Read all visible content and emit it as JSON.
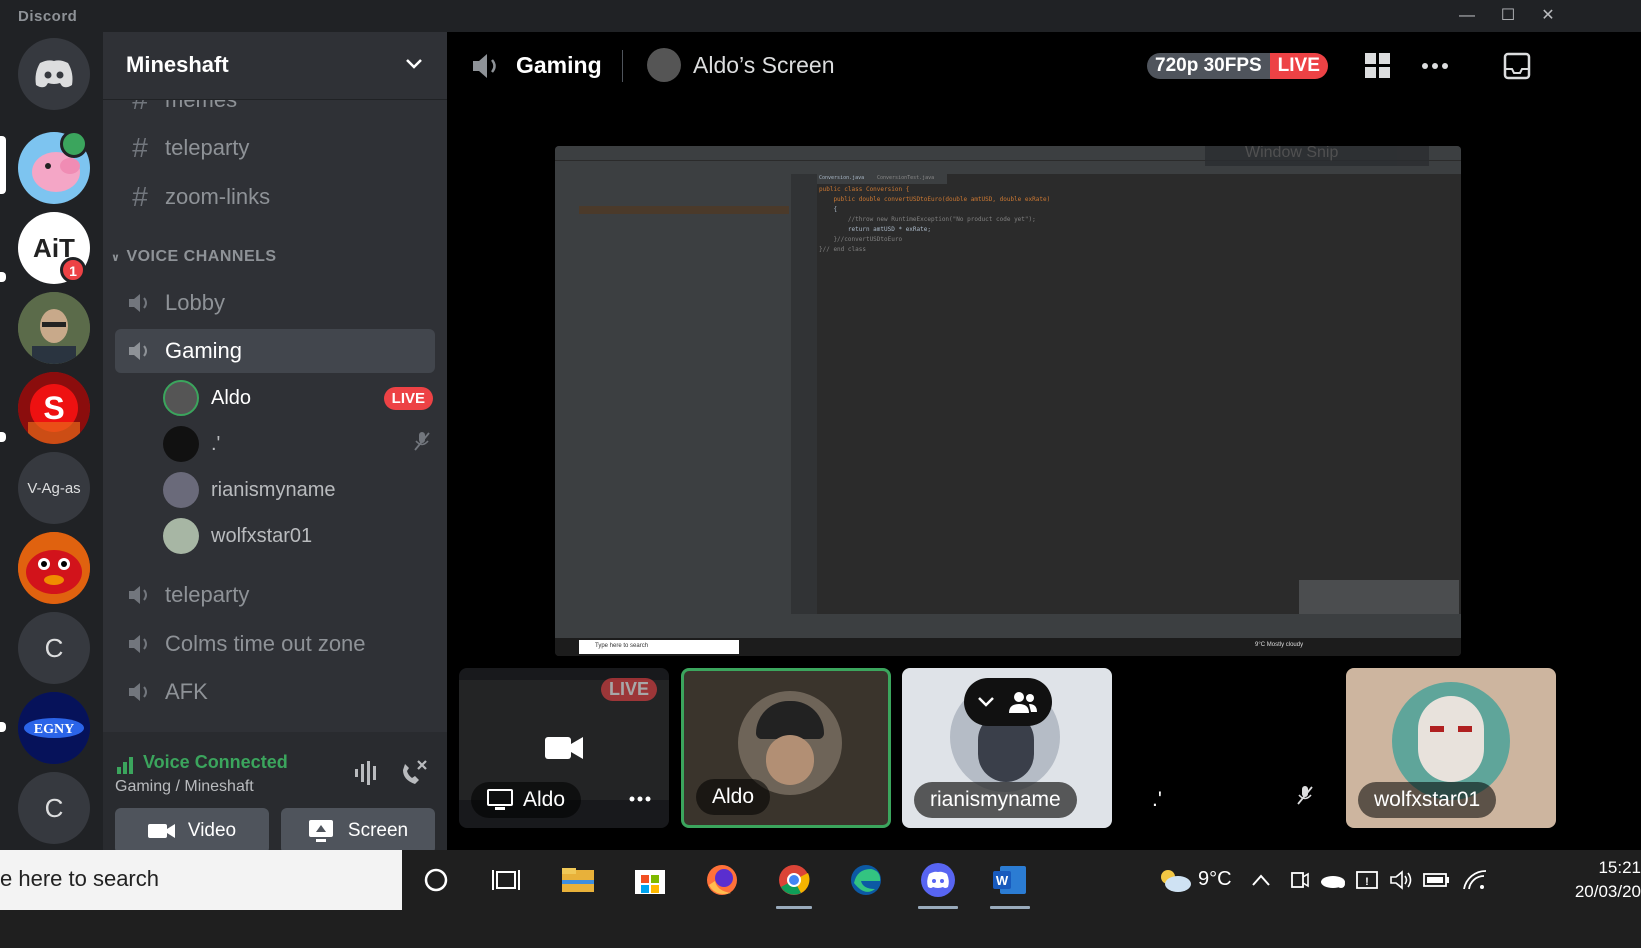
{
  "window": {
    "app_name": "Discord"
  },
  "guild": {
    "name": "Mineshaft"
  },
  "text_channels": [
    {
      "name": "memes"
    },
    {
      "name": "teleparty"
    },
    {
      "name": "zoom-links"
    }
  ],
  "voice_category": "VOICE CHANNELS",
  "voice_channels": [
    {
      "name": "Lobby"
    },
    {
      "name": "Gaming"
    },
    {
      "name": "teleparty"
    },
    {
      "name": "Colms time out zone"
    },
    {
      "name": "AFK"
    }
  ],
  "gaming_members": [
    {
      "name": "Aldo",
      "live": "LIVE"
    },
    {
      "name": ".'"
    },
    {
      "name": "rianismyname"
    },
    {
      "name": "wolfxstar01"
    }
  ],
  "servers": [
    {
      "label": "",
      "icon": "discord-home-icon"
    },
    {
      "label": "",
      "icon": "peppa-server-icon",
      "speaking": true
    },
    {
      "label": "AiT",
      "badge": "1"
    },
    {
      "label": "",
      "icon": "person-server-icon"
    },
    {
      "label": "S",
      "icon": "s-logo-server-icon"
    },
    {
      "label": "V-Ag-as"
    },
    {
      "label": "",
      "icon": "red-creature-server-icon"
    },
    {
      "label": "C"
    },
    {
      "label": "",
      "icon": "blue-logo-server-icon"
    },
    {
      "label": "C"
    }
  ],
  "voice_panel": {
    "status": "Voice Connected",
    "location": "Gaming / Mineshaft",
    "video_label": "Video",
    "screen_label": "Screen"
  },
  "stage": {
    "channel": "Gaming",
    "stream_title": "Aldo’s Screen",
    "quality": "720p 30FPS",
    "live": "LIVE"
  },
  "shared_screen": {
    "code_lines": [
      "public class Conversion {",
      "    public double convertUSDtoEuro(double amtUSD, double exRate)",
      "    {",
      "        //throw new RuntimeException(\"No product code yet\");",
      "        return amtUSD * exRate;",
      "    }//convertUSDtoEuro",
      "}// end class"
    ],
    "tabs": [
      "Conversion.java",
      "ConversionTest.java"
    ],
    "taskbar_search": "Type here to search",
    "weather": "9°C  Mostly cloudy",
    "window_snip": "Window Snip"
  },
  "tiles": [
    {
      "name": "Aldo",
      "live": "LIVE"
    },
    {
      "name": "Aldo"
    },
    {
      "name": "rianismyname"
    },
    {
      "name": ".'"
    },
    {
      "name": "wolfxstar01"
    }
  ],
  "taskbar": {
    "search_placeholder": "e here to search",
    "temperature": "9°C",
    "time": "15:21",
    "date": "20/03/20"
  },
  "colors": {
    "green": "#3ba55d",
    "red": "#ed4245",
    "blurple": "#5865f2"
  }
}
